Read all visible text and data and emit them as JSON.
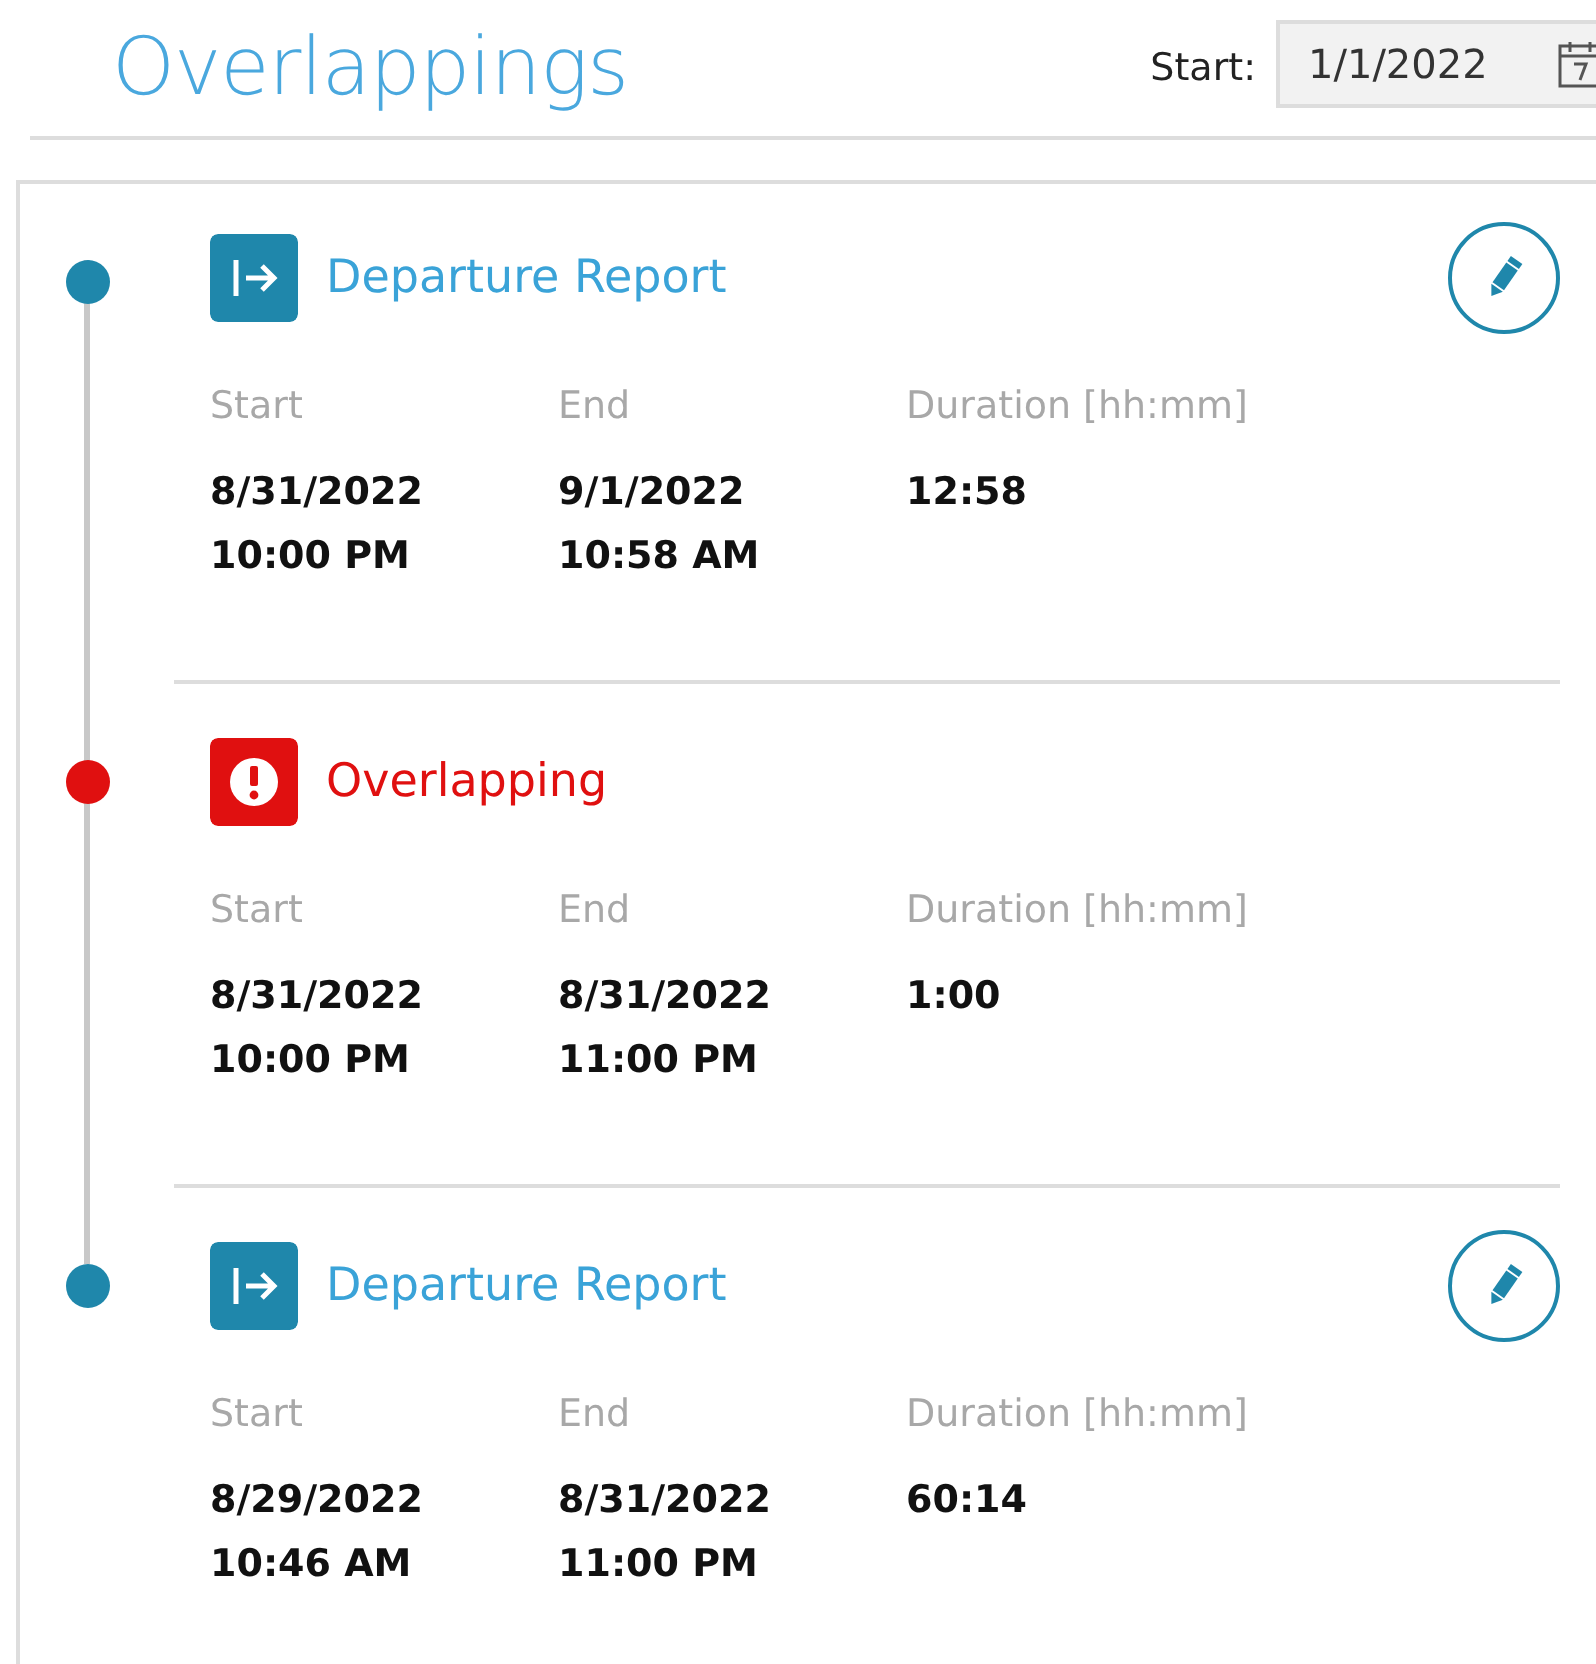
{
  "title": "Overlappings",
  "start_filter": {
    "label": "Start:",
    "value": "1/1/2022"
  },
  "entries": [
    {
      "kind": "departure",
      "title": "Departure Report",
      "editable": true,
      "start_label": "Start",
      "end_label": "End",
      "duration_label": "Duration [hh:mm]",
      "start_date": "8/31/2022",
      "start_time": "10:00 PM",
      "end_date": "9/1/2022",
      "end_time": "10:58 AM",
      "duration": "12:58"
    },
    {
      "kind": "overlap",
      "title": "Overlapping",
      "editable": false,
      "start_label": "Start",
      "end_label": "End",
      "duration_label": "Duration [hh:mm]",
      "start_date": "8/31/2022",
      "start_time": "10:00 PM",
      "end_date": "8/31/2022",
      "end_time": "11:00 PM",
      "duration": "1:00"
    },
    {
      "kind": "departure",
      "title": "Departure Report",
      "editable": true,
      "start_label": "Start",
      "end_label": "End",
      "duration_label": "Duration [hh:mm]",
      "start_date": "8/29/2022",
      "start_time": "10:46 AM",
      "end_date": "8/31/2022",
      "end_time": "11:00 PM",
      "duration": "60:14"
    }
  ]
}
